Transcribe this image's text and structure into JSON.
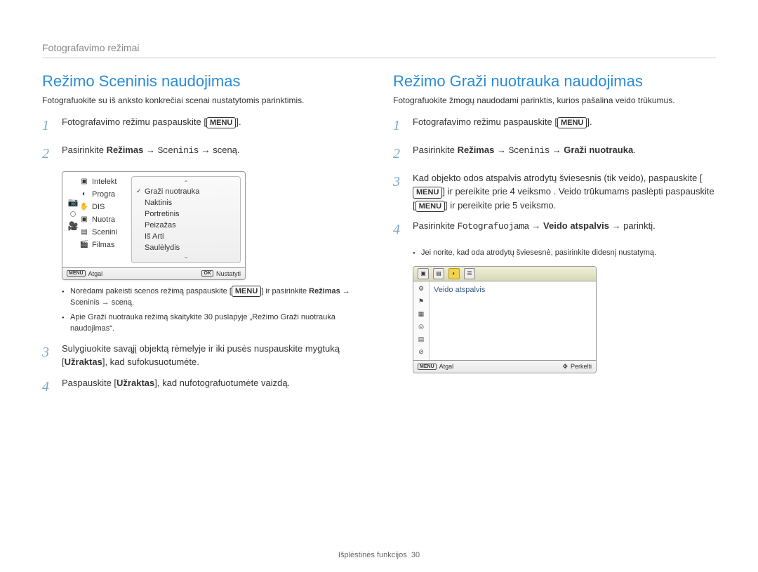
{
  "breadcrumb": "Fotografavimo režimai",
  "left": {
    "title": "Režimo Sceninis naudojimas",
    "intro": "Fotografuokite su iš anksto konkrečiai scenai nustatytomis parinktimis.",
    "step1_a": "Fotografavimo režimu paspauskite [",
    "step1_menu": "MENU",
    "step1_b": "].",
    "step2_a": "Pasirinkite ",
    "step2_bold": "Režimas",
    "step2_b": " → ",
    "step2_c": "Sceninis",
    "step2_d": " → sceną.",
    "screenshot": {
      "left_items": [
        "Intelekt",
        "Progra",
        "DIS",
        "Nuotra",
        "Scenini",
        "Filmas"
      ],
      "popup_items": [
        "Graži nuotrauka",
        "Naktinis",
        "Portretinis",
        "Peizažas",
        "Iš Arti",
        "Saulėlydis"
      ],
      "footer_left": "Atgal",
      "footer_left_tag": "MENU",
      "footer_right": "Nustatyti",
      "footer_right_tag": "OK"
    },
    "bullets": {
      "b1_a": "Norėdami pakeisti scenos režimą paspauskite [",
      "b1_menu": "MENU",
      "b1_b": "] ir pasirinkite ",
      "b1_bold": "Režimas",
      "b1_c": " → Sceninis → sceną.",
      "b2": "Apie Graži nuotrauka režimą skaitykite 30 puslapyje „Režimo Graži nuotrauka naudojimas“."
    },
    "step3_a": "Sulygiuokite savąjį objektą rėmelyje ir iki pusės nuspauskite mygtuką [",
    "step3_bold": "Užraktas",
    "step3_b": "], kad sufokusuotumėte.",
    "step4_a": "Paspauskite [",
    "step4_bold": "Užraktas",
    "step4_b": "], kad nufotografuotumėte vaizdą."
  },
  "right": {
    "title": "Režimo Graži nuotrauka naudojimas",
    "intro": "Fotografuokite žmogų naudodami parinktis, kurios pašalina veido trūkumus.",
    "step1_a": "Fotografavimo režimu paspauskite [",
    "step1_menu": "MENU",
    "step1_b": "].",
    "step2_a": "Pasirinkite ",
    "step2_bold1": "Režimas",
    "step2_b": " → ",
    "step2_c": "Sceninis",
    "step2_d": " → ",
    "step2_bold2": "Graži nuotrauka",
    "step2_e": ".",
    "step3_a": "Kad objekto odos atspalvis atrodytų šviesesnis (tik veido), paspauskite [",
    "step3_menu1": "MENU",
    "step3_b": "] ir pereikite prie 4 veiksmo . Veido trūkumams paslėpti paspauskite [",
    "step3_menu2": "MENU",
    "step3_c": "] ir pereikite prie 5 veiksmo.",
    "step4_a": "Pasirinkite ",
    "step4_c1": "Fotografuojama",
    "step4_b": " → ",
    "step4_bold": "Veido atspalvis",
    "step4_c": " → parinktį.",
    "bullet1": "Jei norite, kad oda atrodytų šviesesnė, pasirinkite didesnį nustatymą.",
    "screenshot2": {
      "content_label": "Veido atspalvis",
      "footer_left_tag": "MENU",
      "footer_left": "Atgal",
      "footer_right_tag": "✥",
      "footer_right": "Perkelti"
    }
  },
  "page_footer_label": "Išplėstinės funkcijos",
  "page_number": "30"
}
